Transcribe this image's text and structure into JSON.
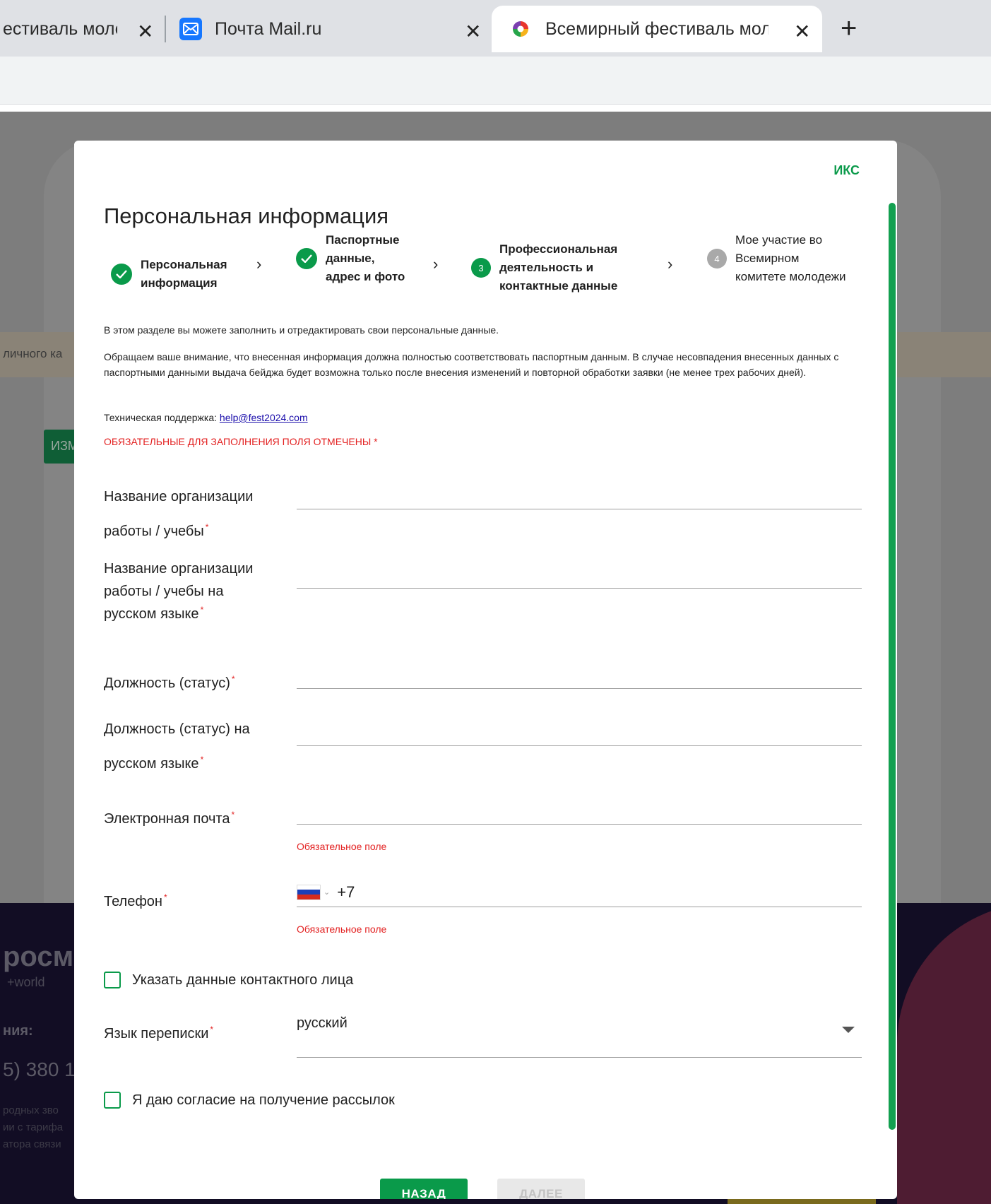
{
  "browser": {
    "tabs": [
      {
        "title": "естиваль моло",
        "close": "✕"
      },
      {
        "title": "Почта Mail.ru",
        "close": "✕"
      },
      {
        "title": "Всемирный фестиваль моло",
        "close": "✕"
      }
    ],
    "new_tab": "+"
  },
  "background_page": {
    "warning_fragment": "личного ка",
    "edit_button_fragment": "ИЗМ",
    "footer": {
      "brand": "росм",
      "brand_sub": "+world",
      "contacts_label": "ния:",
      "phone_fragment": "5) 380 1",
      "small_lines": [
        "родных зво",
        "ии с тарифа",
        "атора связи"
      ]
    }
  },
  "modal": {
    "close_label": "ИКС",
    "title": "Персональная информация",
    "steps": [
      {
        "label": "Персональная информация",
        "state": "done"
      },
      {
        "label": "Паспортные данные, адрес и фото",
        "state": "done"
      },
      {
        "number": "3",
        "label": "Профессиональная деятельность и контактные данные",
        "state": "current"
      },
      {
        "number": "4",
        "label": "Мое участие во Всемирном комитете молодежи",
        "state": "todo"
      }
    ],
    "step_arrow": "›",
    "info_1": "В этом разделе вы можете заполнить и отредактировать свои персональные данные.",
    "info_2": "Обращаем ваше внимание, что внесенная информация должна полностью соответствовать паспортным данным. В случае несовпадения внесенных данных с паспортными данными выдача бейджа будет возможна только после внесения изменений и повторной обработки заявки (не менее трех рабочих дней).",
    "support_label": "Техническая поддержка: ",
    "support_email": "help@fest2024.com",
    "required_note": "ОБЯЗАТЕЛЬНЫЕ ДЛЯ ЗАПОЛНЕНИЯ ПОЛЯ ОТМЕЧЕНЫ *",
    "required_mark": "*",
    "fields": {
      "org_name": {
        "label": "Название организации работы / учебы",
        "value": ""
      },
      "org_name_ru": {
        "label": "Название организации работы / учебы на русском языке",
        "value": ""
      },
      "position": {
        "label": "Должность (статус)",
        "value": ""
      },
      "position_ru": {
        "label": "Должность (статус) на русском языке",
        "value": ""
      },
      "email": {
        "label": "Электронная почта",
        "value": "",
        "error": "Обязательное поле"
      },
      "phone": {
        "label": "Телефон",
        "country": "Russia",
        "code": "+7",
        "error": "Обязательное поле"
      },
      "contact_person": {
        "label": "Указать данные контактного лица",
        "checked": false
      },
      "language": {
        "label": "Язык переписки",
        "value": "русский"
      },
      "newsletter": {
        "label": "Я даю согласие на получение рассылок",
        "checked": false
      }
    },
    "buttons": {
      "back": "НАЗАД",
      "next": "ДАЛЕЕ"
    }
  },
  "colors": {
    "accent_green": "#0a9a4a",
    "error_red": "#e32222",
    "link_blue": "#1a0dab"
  }
}
